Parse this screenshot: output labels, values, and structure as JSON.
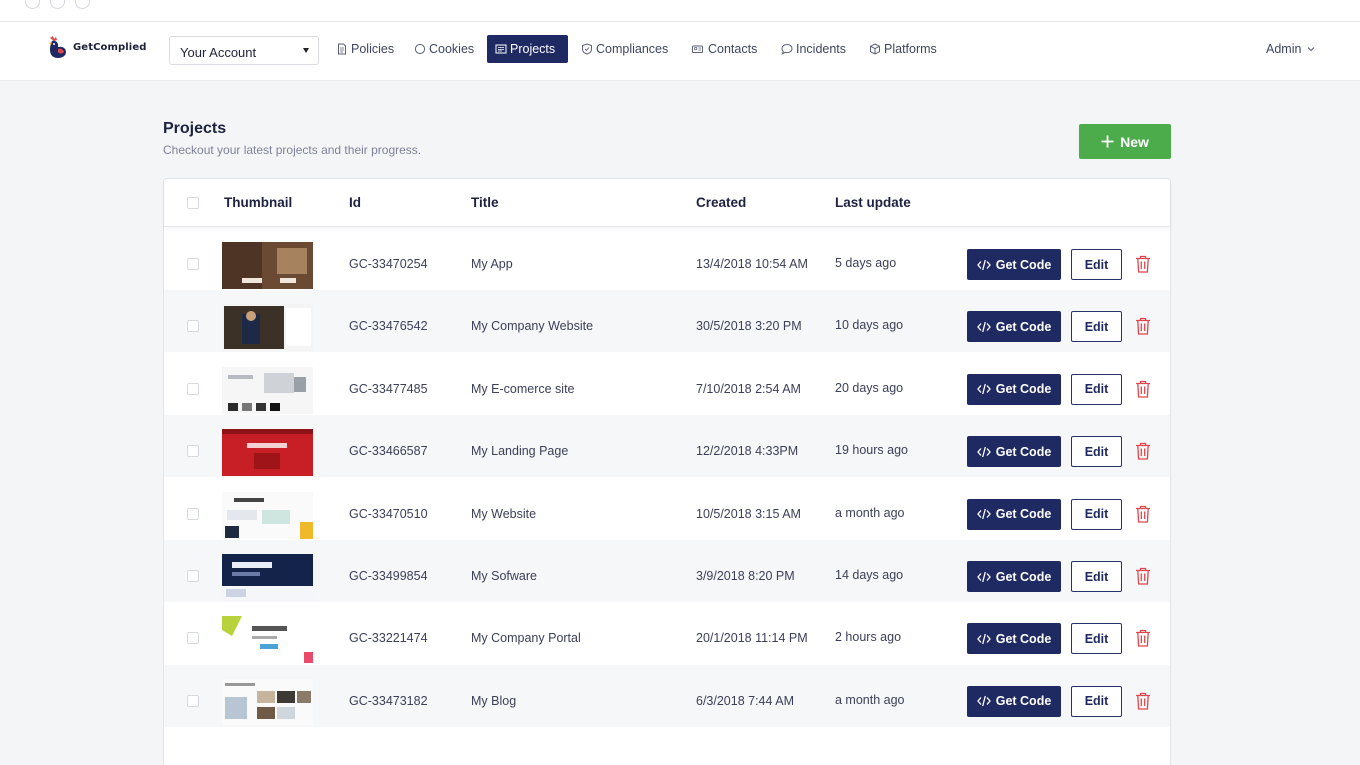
{
  "app": {
    "brand": "GetComplied",
    "account_select": "Your Account",
    "user": "Admin"
  },
  "nav": [
    {
      "label": "Policies",
      "icon": "document-icon",
      "active": false
    },
    {
      "label": "Cookies",
      "icon": "circle-icon",
      "active": false
    },
    {
      "label": "Projects",
      "icon": "list-icon",
      "active": true
    },
    {
      "label": "Compliances",
      "icon": "shield-icon",
      "active": false
    },
    {
      "label": "Contacts",
      "icon": "contacts-icon",
      "active": false
    },
    {
      "label": "Incidents",
      "icon": "chat-icon",
      "active": false
    },
    {
      "label": "Platforms",
      "icon": "cube-icon",
      "active": false
    }
  ],
  "page": {
    "title": "Projects",
    "subtitle": "Checkout your latest projects and their progress.",
    "new_label": "New"
  },
  "table": {
    "columns": [
      "Thumbnail",
      "Id",
      "Title",
      "Created",
      "Last update"
    ],
    "get_code_label": "Get Code",
    "edit_label": "Edit",
    "rows": [
      {
        "id": "GC-33470254",
        "title": "My App",
        "created": "13/4/2018 10:54 AM",
        "updated": "5 days ago"
      },
      {
        "id": "GC-33476542",
        "title": "My Company Website",
        "created": "30/5/2018 3:20 PM",
        "updated": "10 days ago"
      },
      {
        "id": "GC-33477485",
        "title": "My E-comerce site",
        "created": "7/10/2018 2:54 AM",
        "updated": "20 days ago"
      },
      {
        "id": "GC-33466587",
        "title": "My Landing Page",
        "created": "12/2/2018 4:33PM",
        "updated": "19 hours ago"
      },
      {
        "id": "GC-33470510",
        "title": "My Website",
        "created": "10/5/2018 3:15 AM",
        "updated": "a month ago"
      },
      {
        "id": "GC-33499854",
        "title": "My Sofware",
        "created": "3/9/2018 8:20 PM",
        "updated": "14 days ago"
      },
      {
        "id": "GC-33221474",
        "title": "My Company Portal",
        "created": "20/1/2018 11:14 PM",
        "updated": "2 hours ago"
      },
      {
        "id": "GC-33473182",
        "title": "My Blog",
        "created": "6/3/2018 7:44 AM",
        "updated": "a month ago"
      }
    ]
  },
  "colors": {
    "primary": "#1f2a63",
    "success": "#4cac4c",
    "danger": "#e0474c",
    "background": "#f4f5f7"
  }
}
